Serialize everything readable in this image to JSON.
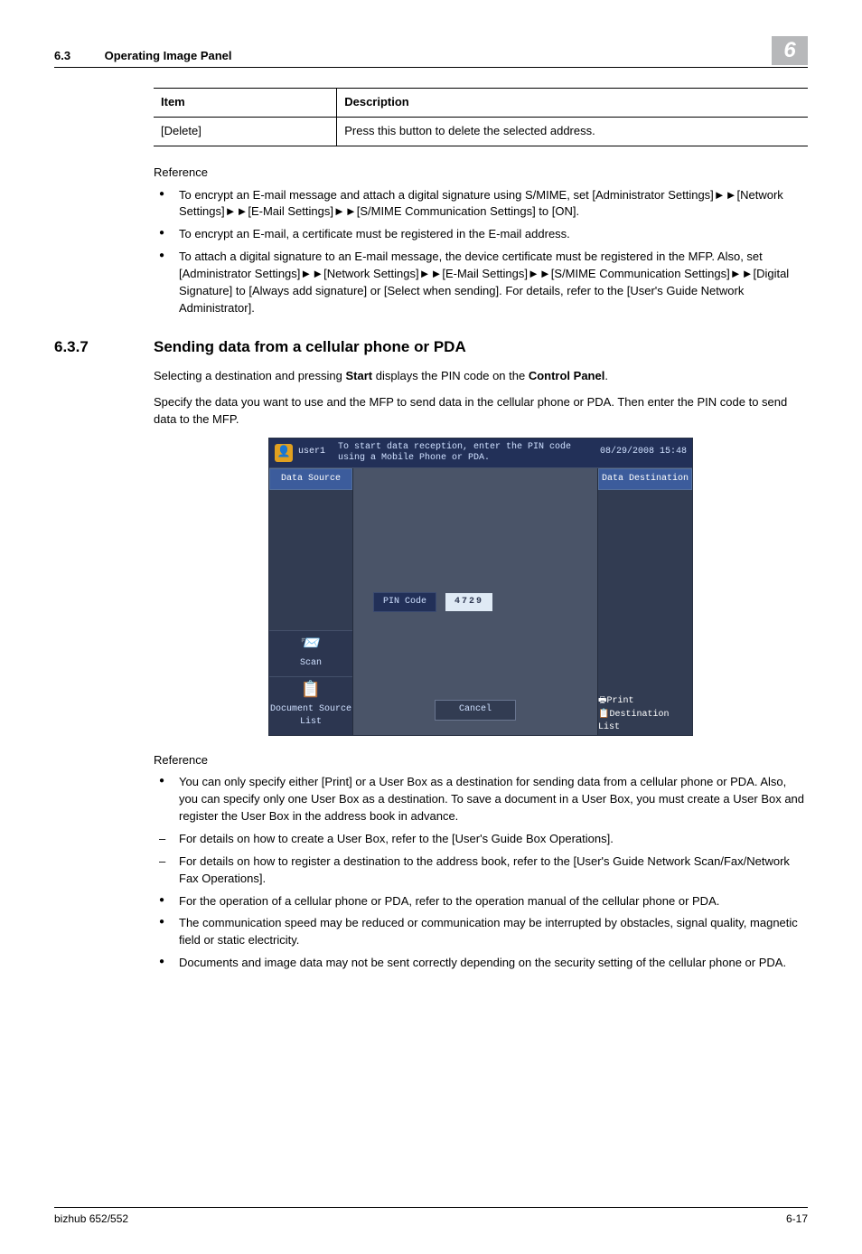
{
  "header": {
    "section_number": "6.3",
    "section_title": "Operating Image Panel",
    "chapter_badge": "6"
  },
  "table": {
    "head_item": "Item",
    "head_desc": "Description",
    "row_item": "[Delete]",
    "row_desc": "Press this button to delete the selected address."
  },
  "ref1": {
    "heading": "Reference",
    "b1a": "To encrypt an E-mail message and attach a digital signature using S/MIME, set [Administrator Settings]",
    "b1b": "[Network Settings]",
    "b1c": "[E-Mail Settings]",
    "b1d": "[S/MIME Communication Settings] to [ON].",
    "b2": "To encrypt an E-mail, a certificate must be registered in the E-mail address.",
    "b3a": "To attach a digital signature to an E-mail message, the device certificate must be registered in the MFP. Also, set [Administrator Settings]",
    "b3b": "[Network Settings]",
    "b3c": "[E-Mail Settings]",
    "b3d": "[S/MIME Communication Settings]",
    "b3e": "[Digital Signature] to [Always add signature] or [Select when sending]. For details, refer to the [User's Guide Network Administrator]."
  },
  "section": {
    "num": "6.3.7",
    "title": "Sending data from a cellular phone or PDA",
    "p1a": "Selecting a destination and pressing ",
    "p1b": "Start",
    "p1c": " displays the PIN code on the ",
    "p1d": "Control Panel",
    "p1e": ".",
    "p2": "Specify the data you want to use and the MFP to send data in the cellular phone or PDA. Then enter the PIN code to send data to the MFP."
  },
  "device": {
    "user": "user1",
    "instruction": "To start data reception, enter the PIN code using a Mobile Phone or PDA.",
    "timestamp": "08/29/2008  15:48",
    "data_source": "Data Source",
    "data_destination": "Data Destination",
    "pin_label": "PIN Code",
    "pin_value": "4729",
    "cancel": "Cancel",
    "scan": "Scan",
    "doc_source_list": "Document Source List",
    "print": "Print",
    "dest_list": "Destination List"
  },
  "ref2": {
    "heading": "Reference",
    "b1": "You can only specify either [Print] or a User Box as a destination for sending data from a cellular phone or PDA. Also, you can specify only one User Box as a destination. To save a document in a User Box, you must create a User Box and register the User Box in the address book in advance.",
    "d1": "For details on how to create a User Box, refer to the [User's Guide Box Operations].",
    "d2": "For details on how to register a destination to the address book, refer to the [User's Guide Network Scan/Fax/Network Fax Operations].",
    "b2": "For the operation of a cellular phone or PDA, refer to the operation manual of the cellular phone or PDA.",
    "b3": "The communication speed may be reduced or communication may be interrupted by obstacles, signal quality, magnetic field or static electricity.",
    "b4": "Documents and image data may not be sent correctly depending on the security setting of the cellular phone or PDA."
  },
  "footer": {
    "left": "bizhub 652/552",
    "right": "6-17"
  },
  "arrow": "►►"
}
